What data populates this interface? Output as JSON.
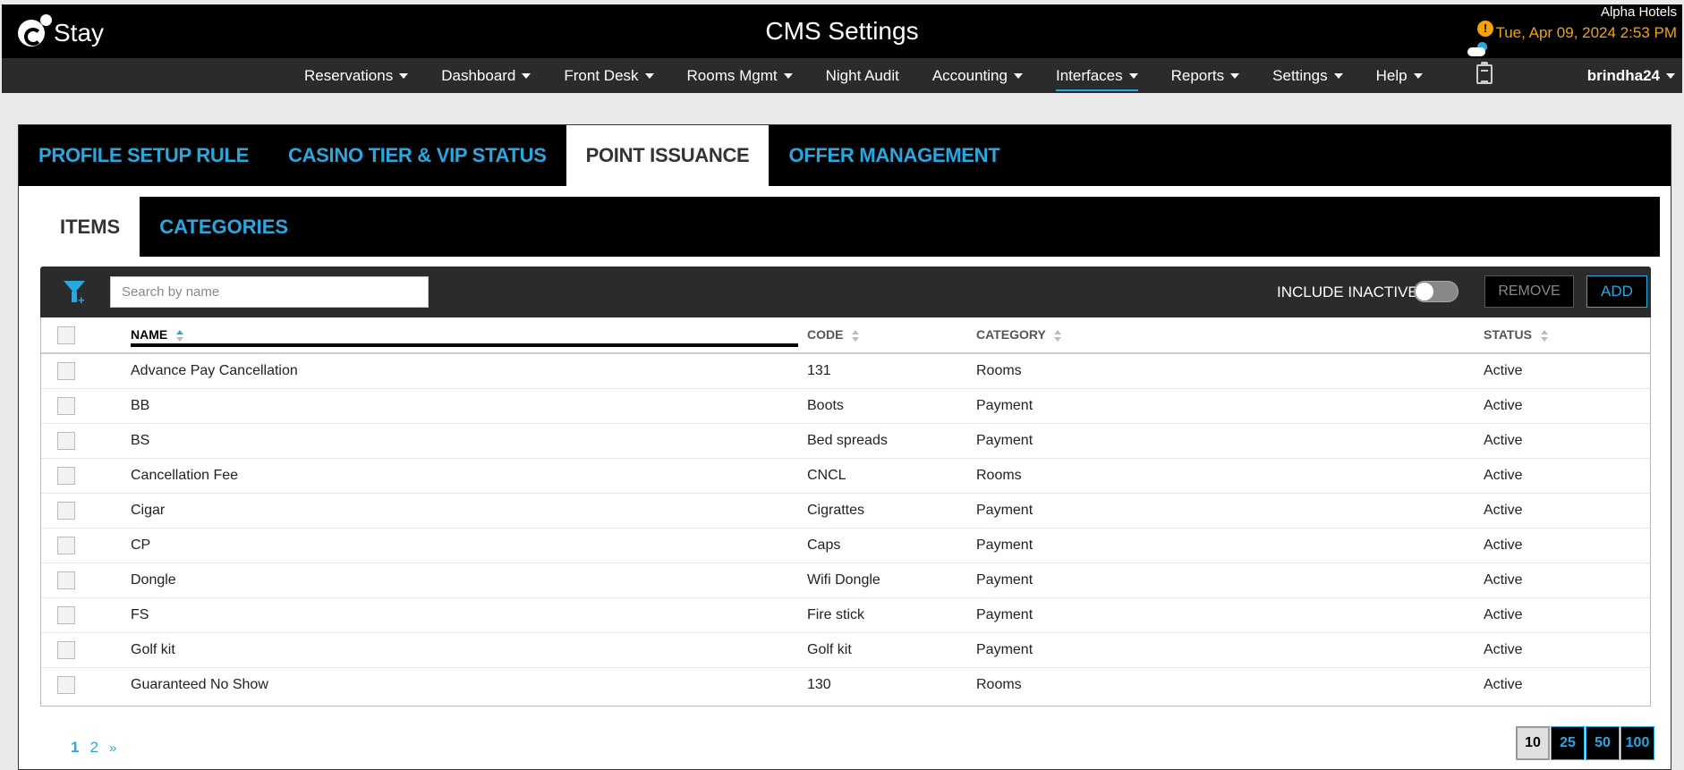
{
  "header": {
    "brand": "Stay",
    "title": "CMS Settings",
    "hotel": "Alpha Hotels",
    "datetime": "Tue, Apr 09, 2024 2:53 PM",
    "alert_symbol": "!"
  },
  "nav": {
    "items": [
      {
        "label": "Reservations",
        "dropdown": true
      },
      {
        "label": "Dashboard",
        "dropdown": true
      },
      {
        "label": "Front Desk",
        "dropdown": true
      },
      {
        "label": "Rooms Mgmt",
        "dropdown": true
      },
      {
        "label": "Night Audit",
        "dropdown": false
      },
      {
        "label": "Accounting",
        "dropdown": true
      },
      {
        "label": "Interfaces",
        "dropdown": true,
        "active": true
      },
      {
        "label": "Reports",
        "dropdown": true
      },
      {
        "label": "Settings",
        "dropdown": true
      },
      {
        "label": "Help",
        "dropdown": true
      }
    ],
    "user": "brindha24"
  },
  "main_tabs": [
    {
      "label": "PROFILE SETUP RULE",
      "active": false
    },
    {
      "label": "CASINO TIER & VIP STATUS",
      "active": false
    },
    {
      "label": "POINT ISSUANCE",
      "active": true
    },
    {
      "label": "OFFER MANAGEMENT",
      "active": false
    }
  ],
  "sub_tabs": [
    {
      "label": "ITEMS",
      "active": true
    },
    {
      "label": "CATEGORIES",
      "active": false
    }
  ],
  "toolbar": {
    "search_placeholder": "Search by name",
    "search_value": "",
    "include_inactive_label": "INCLUDE INACTIVE",
    "include_inactive_on": false,
    "remove_label": "REMOVE",
    "add_label": "ADD"
  },
  "table": {
    "columns": {
      "name": "NAME",
      "code": "CODE",
      "category": "CATEGORY",
      "status": "STATUS"
    },
    "rows": [
      {
        "name": "Advance Pay Cancellation",
        "code": "131",
        "category": "Rooms",
        "status": "Active"
      },
      {
        "name": "BB",
        "code": "Boots",
        "category": "Payment",
        "status": "Active"
      },
      {
        "name": "BS",
        "code": "Bed spreads",
        "category": "Payment",
        "status": "Active"
      },
      {
        "name": "Cancellation Fee",
        "code": "CNCL",
        "category": "Rooms",
        "status": "Active"
      },
      {
        "name": "Cigar",
        "code": "Cigrattes",
        "category": "Payment",
        "status": "Active"
      },
      {
        "name": "CP",
        "code": "Caps",
        "category": "Payment",
        "status": "Active"
      },
      {
        "name": "Dongle",
        "code": "Wifi Dongle",
        "category": "Payment",
        "status": "Active"
      },
      {
        "name": "FS",
        "code": "Fire stick",
        "category": "Payment",
        "status": "Active"
      },
      {
        "name": "Golf kit",
        "code": "Golf kit",
        "category": "Payment",
        "status": "Active"
      },
      {
        "name": "Guaranteed No Show",
        "code": "130",
        "category": "Rooms",
        "status": "Active"
      }
    ]
  },
  "pagination": {
    "pages": [
      "1",
      "2"
    ],
    "current": "1",
    "next": "»",
    "page_sizes": [
      "10",
      "25",
      "50",
      "100"
    ],
    "page_size_selected": "10"
  },
  "colors": {
    "accent": "#29a8e0",
    "warning": "#f5a300",
    "header_bg": "#000000",
    "nav_bg": "#2b2b2b"
  }
}
